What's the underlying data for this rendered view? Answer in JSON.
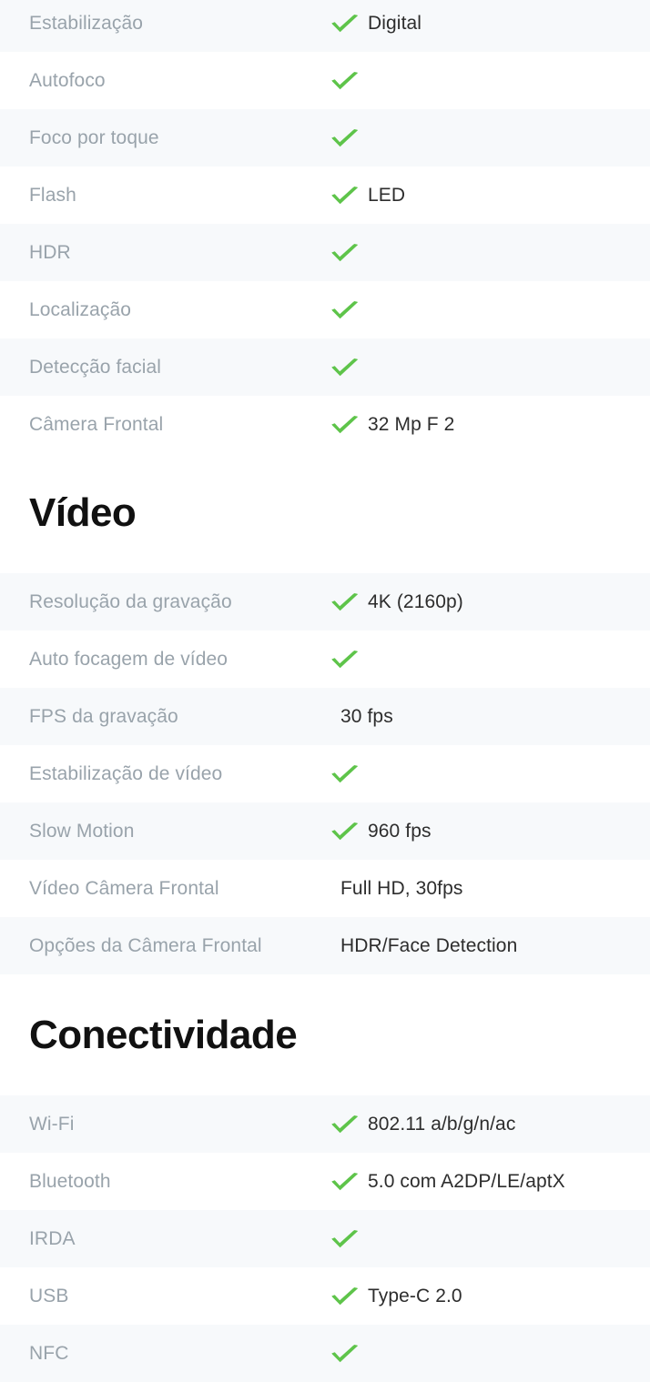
{
  "theme": {
    "stripe_background": "#f7f9fb",
    "row_background": "#ffffff",
    "label_color": "#99a3ab",
    "value_color": "#2d2d2d",
    "check_color": "#5ec44a",
    "heading_color": "#111111"
  },
  "icons": {
    "check": "check-icon"
  },
  "sections": [
    {
      "id": "camera-continued",
      "heading": null,
      "rows": [
        {
          "label": "Estabilização",
          "check": true,
          "value": "Digital"
        },
        {
          "label": "Autofoco",
          "check": true,
          "value": ""
        },
        {
          "label": "Foco por toque",
          "check": true,
          "value": ""
        },
        {
          "label": "Flash",
          "check": true,
          "value": "LED"
        },
        {
          "label": "HDR",
          "check": true,
          "value": ""
        },
        {
          "label": "Localização",
          "check": true,
          "value": ""
        },
        {
          "label": "Detecção facial",
          "check": true,
          "value": ""
        },
        {
          "label": "Câmera Frontal",
          "check": true,
          "value": "32 Mp F 2"
        }
      ]
    },
    {
      "id": "video",
      "heading": "Vídeo",
      "rows": [
        {
          "label": "Resolução da gravação",
          "check": true,
          "value": "4K (2160p)"
        },
        {
          "label": "Auto focagem de vídeo",
          "check": true,
          "value": ""
        },
        {
          "label": "FPS da gravação",
          "check": false,
          "value": "30 fps"
        },
        {
          "label": "Estabilização de vídeo",
          "check": true,
          "value": ""
        },
        {
          "label": "Slow Motion",
          "check": true,
          "value": "960 fps"
        },
        {
          "label": "Vídeo Câmera Frontal",
          "check": false,
          "value": "Full HD, 30fps"
        },
        {
          "label": "Opções da Câmera Frontal",
          "check": false,
          "value": "HDR/Face Detection"
        }
      ]
    },
    {
      "id": "conectividade",
      "heading": "Conectividade",
      "rows": [
        {
          "label": "Wi-Fi",
          "check": true,
          "value": "802.11 a/b/g/n/ac"
        },
        {
          "label": "Bluetooth",
          "check": true,
          "value": "5.0 com A2DP/LE/aptX"
        },
        {
          "label": "IRDA",
          "check": true,
          "value": ""
        },
        {
          "label": "USB",
          "check": true,
          "value": "Type-C 2.0"
        },
        {
          "label": "NFC",
          "check": true,
          "value": ""
        }
      ]
    }
  ]
}
